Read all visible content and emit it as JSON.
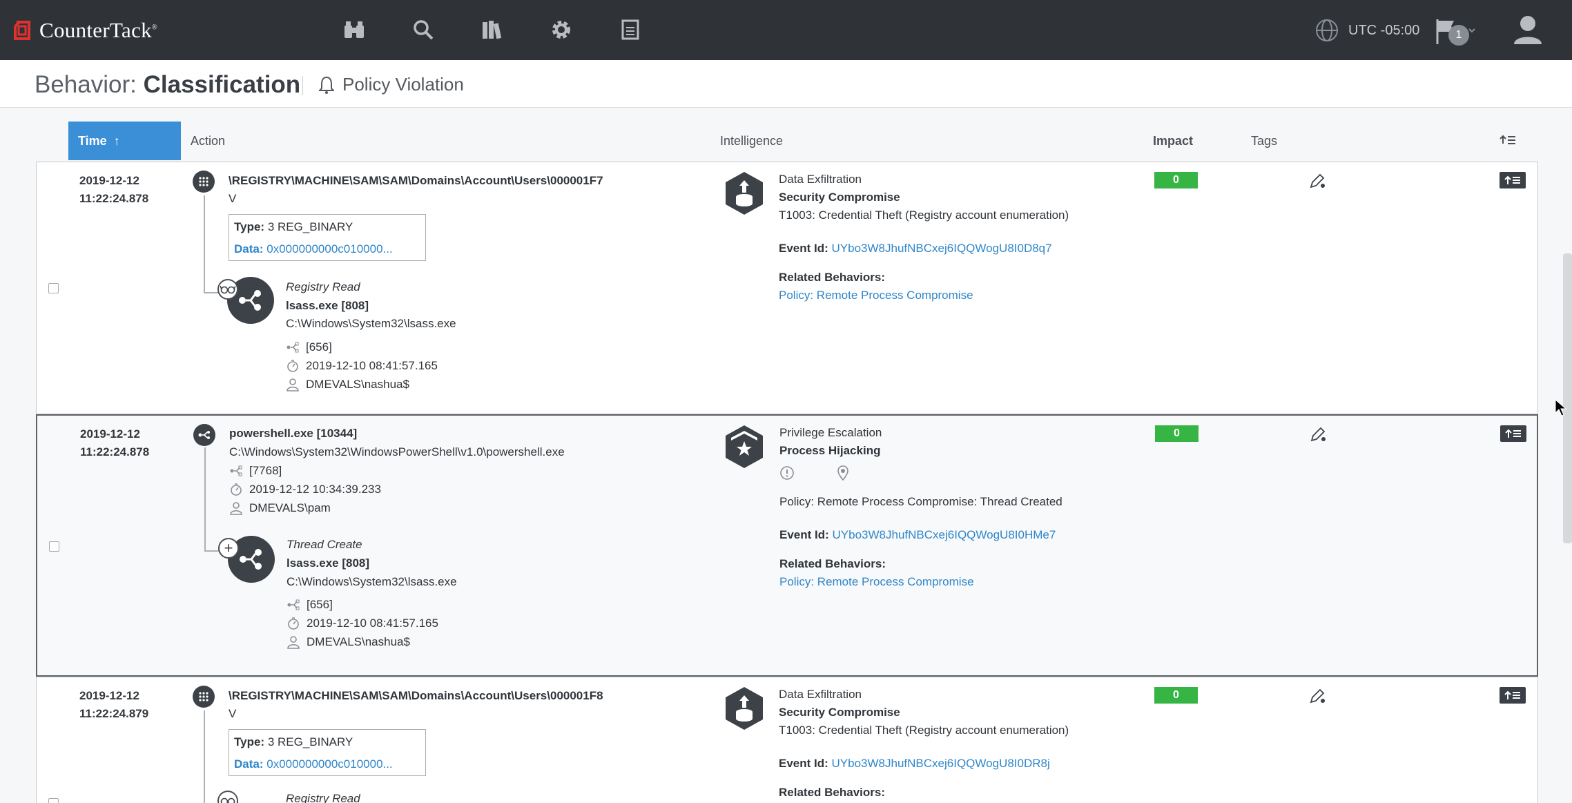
{
  "brand": {
    "name": "CounterTack",
    "mark": "®",
    "accent": "#e2312d"
  },
  "nav": {
    "items": [
      "binoculars-icon",
      "search-icon",
      "library-icon",
      "gear-icon",
      "report-icon"
    ]
  },
  "header_right": {
    "timezone": "UTC -05:00",
    "flag_count": "1"
  },
  "page": {
    "title_prefix": "Behavior:",
    "title_main": "Classification",
    "policy_label": "Policy Violation"
  },
  "columns": {
    "time": "Time",
    "sort_arrow": "↑",
    "action": "Action",
    "intelligence": "Intelligence",
    "impact": "Impact",
    "tags": "Tags"
  },
  "rows": [
    {
      "date": "2019-12-12",
      "time": "11:22:24.878",
      "action": {
        "kind": "registry",
        "path": "\\REGISTRY\\MACHINE\\SAM\\SAM\\Domains\\Account\\Users\\000001F7",
        "sub": "V",
        "type_label": "Type:",
        "type_value": "3 REG_BINARY",
        "data_label": "Data:",
        "data_value": "0x000000000c010000...",
        "child_op": "Registry Read",
        "child_proc": "lsass.exe [808]",
        "child_path": "C:\\Windows\\System32\\lsass.exe",
        "child_ppid": "[656]",
        "child_time": "2019-12-10 08:41:57.165",
        "child_user": "DMEVALS\\nashua$"
      },
      "intel": {
        "category": "Data Exfiltration",
        "sub": "Security Compromise",
        "technique": "T1003: Credential Theft (Registry account enumeration)",
        "event_label": "Event Id:",
        "event_id": "UYbo3W8JhufNBCxej6IQQWogU8I0D8q7",
        "related_label": "Related Behaviors:",
        "related": "Policy: Remote Process Compromise"
      },
      "impact": "0"
    },
    {
      "date": "2019-12-12",
      "time": "11:22:24.878",
      "action": {
        "kind": "process",
        "proc": "powershell.exe [10344]",
        "path": "C:\\Windows\\System32\\WindowsPowerShell\\v1.0\\powershell.exe",
        "ppid": "[7768]",
        "ptime": "2019-12-12 10:34:39.233",
        "user": "DMEVALS\\pam",
        "child_op": "Thread Create",
        "child_proc": "lsass.exe [808]",
        "child_path": "C:\\Windows\\System32\\lsass.exe",
        "child_ppid": "[656]",
        "child_time": "2019-12-10 08:41:57.165",
        "child_user": "DMEVALS\\nashua$"
      },
      "intel": {
        "category": "Privilege Escalation",
        "sub": "Process Hijacking",
        "policy": "Policy: Remote Process Compromise: Thread Created",
        "event_label": "Event Id:",
        "event_id": "UYbo3W8JhufNBCxej6IQQWogU8I0HMe7",
        "related_label": "Related Behaviors:",
        "related": "Policy: Remote Process Compromise"
      },
      "impact": "0"
    },
    {
      "date": "2019-12-12",
      "time": "11:22:24.879",
      "action": {
        "kind": "registry",
        "path": "\\REGISTRY\\MACHINE\\SAM\\SAM\\Domains\\Account\\Users\\000001F8",
        "sub": "V",
        "type_label": "Type:",
        "type_value": "3 REG_BINARY",
        "data_label": "Data:",
        "data_value": "0x000000000c010000...",
        "child_op": "Registry Read"
      },
      "intel": {
        "category": "Data Exfiltration",
        "sub": "Security Compromise",
        "technique": "T1003: Credential Theft (Registry account enumeration)",
        "event_label": "Event Id:",
        "event_id": "UYbo3W8JhufNBCxej6IQQWogU8I0DR8j",
        "related_label": "Related Behaviors:"
      },
      "impact": "0"
    }
  ]
}
